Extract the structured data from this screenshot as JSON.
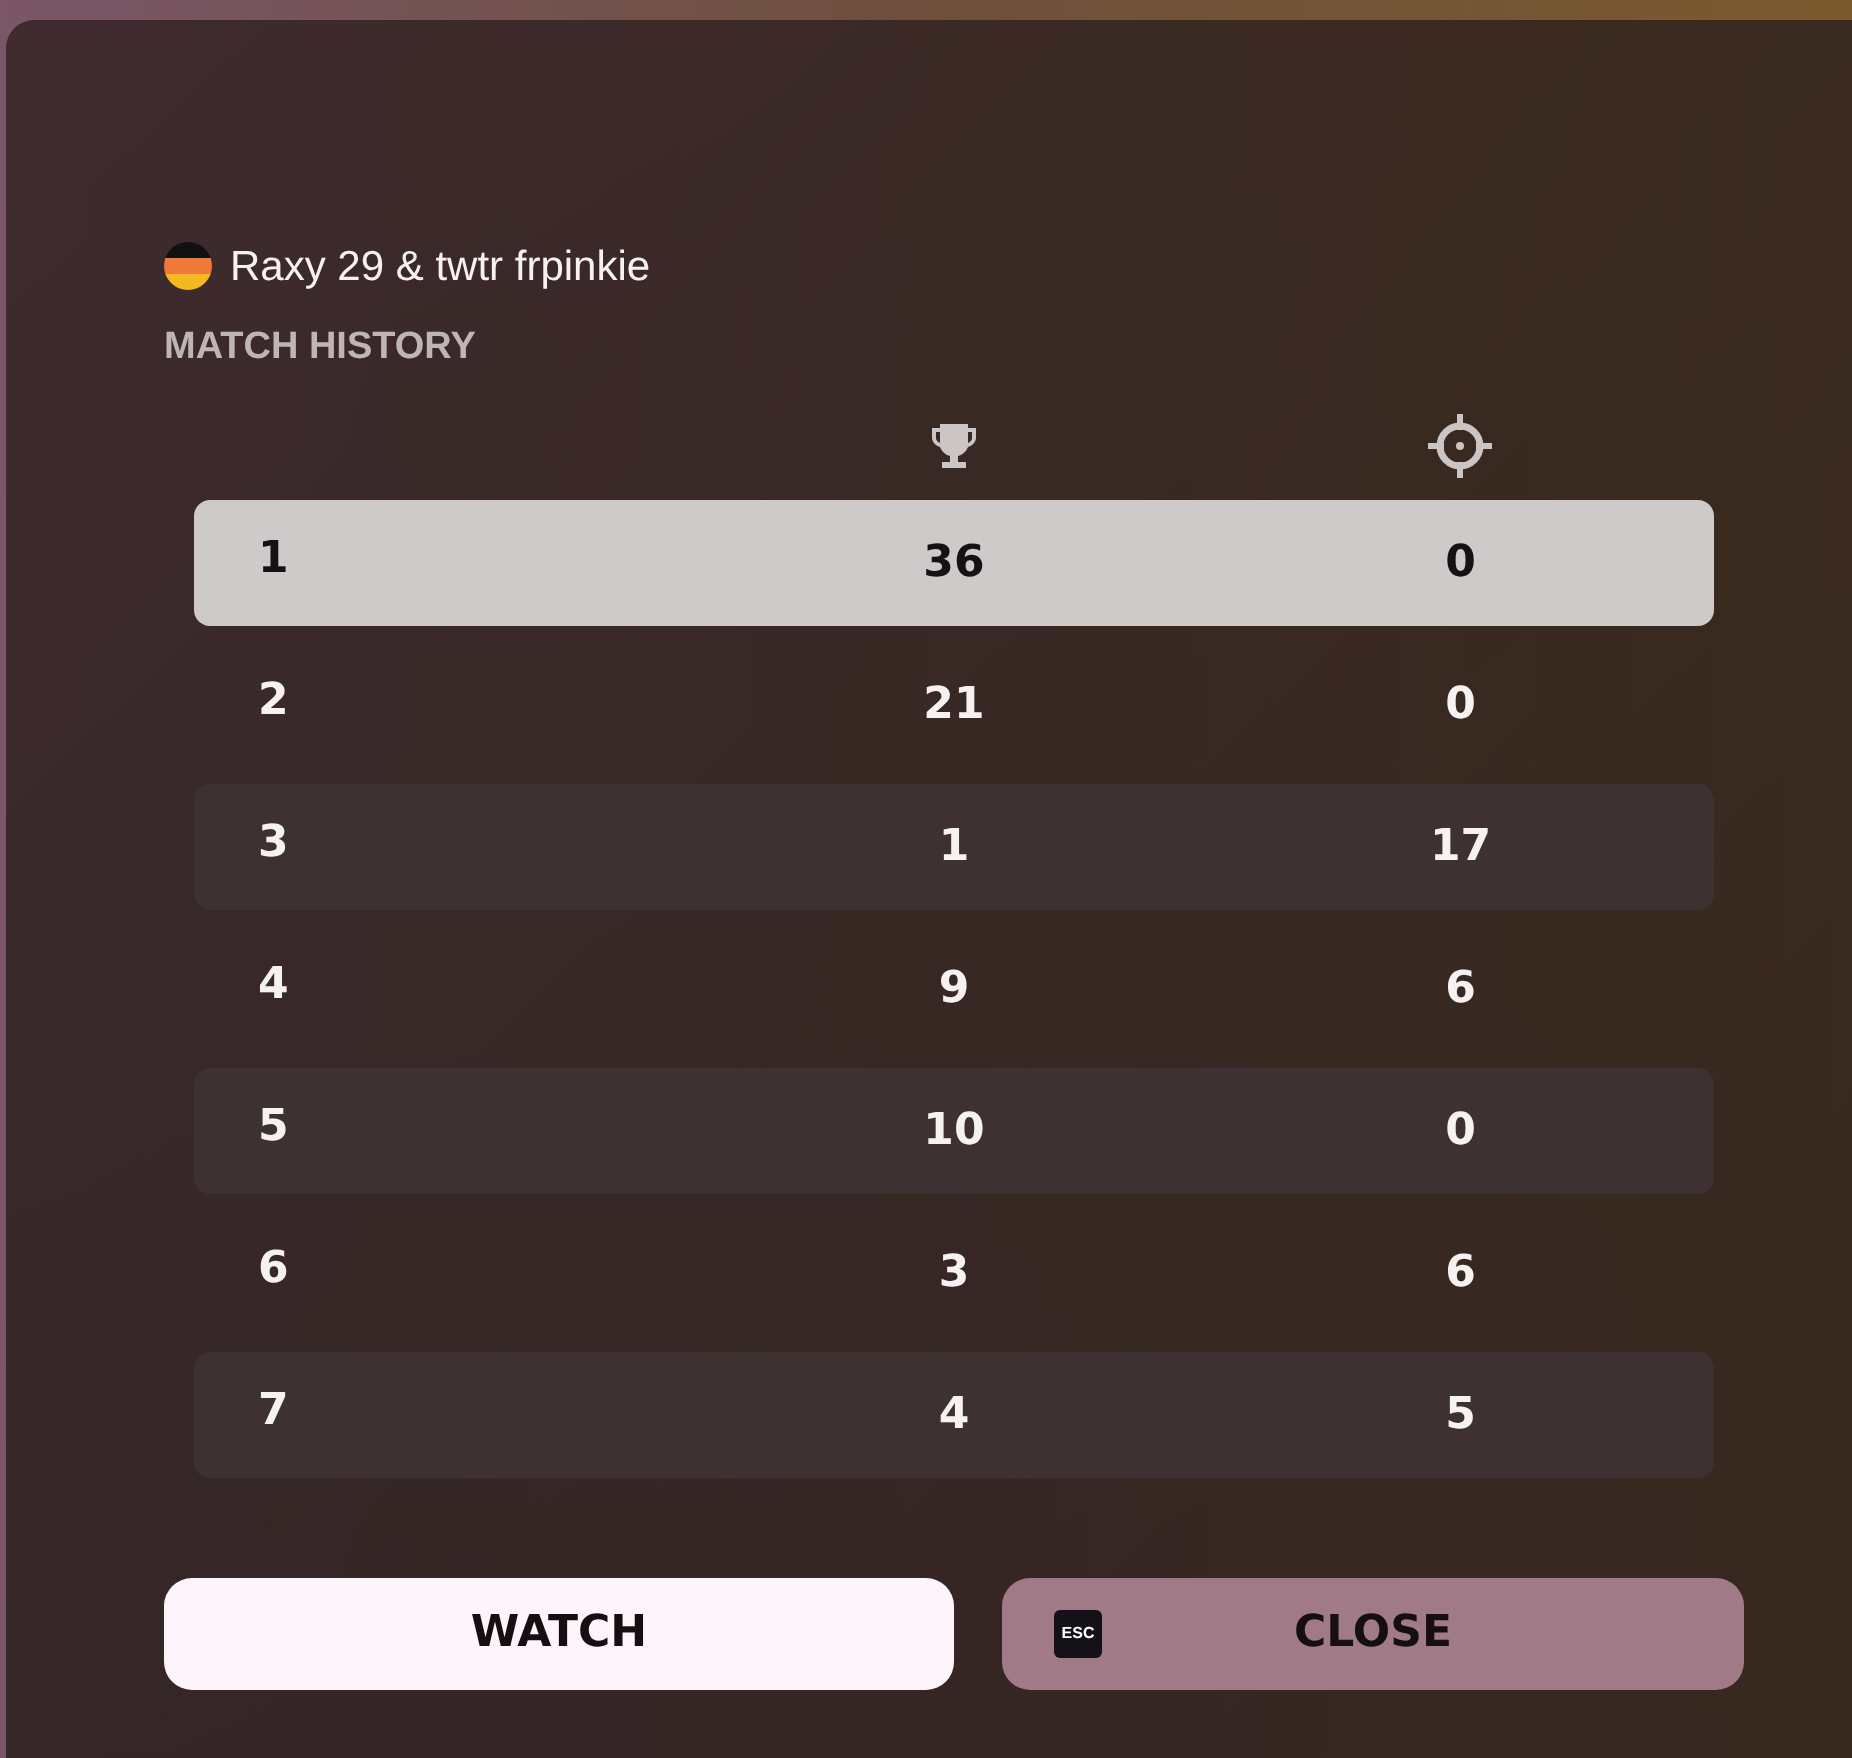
{
  "player": {
    "name": "Raxy 29 & twtr frpinkie"
  },
  "section_title": "MATCH HISTORY",
  "table": {
    "rows": [
      {
        "cells": [
          "1",
          "36",
          "0"
        ],
        "selected": true
      },
      {
        "cells": [
          "2",
          "21",
          "0"
        ],
        "selected": false
      },
      {
        "cells": [
          "3",
          "1",
          "17"
        ],
        "selected": false
      },
      {
        "cells": [
          "4",
          "9",
          "6"
        ],
        "selected": false
      },
      {
        "cells": [
          "5",
          "10",
          "0"
        ],
        "selected": false
      },
      {
        "cells": [
          "6",
          "3",
          "6"
        ],
        "selected": false
      },
      {
        "cells": [
          "7",
          "4",
          "5"
        ],
        "selected": false
      }
    ]
  },
  "buttons": [
    {
      "kind": "primary",
      "label": "WATCH"
    },
    {
      "kind": "secondary",
      "label": "CLOSE",
      "key_hint": "ESC"
    }
  ]
}
